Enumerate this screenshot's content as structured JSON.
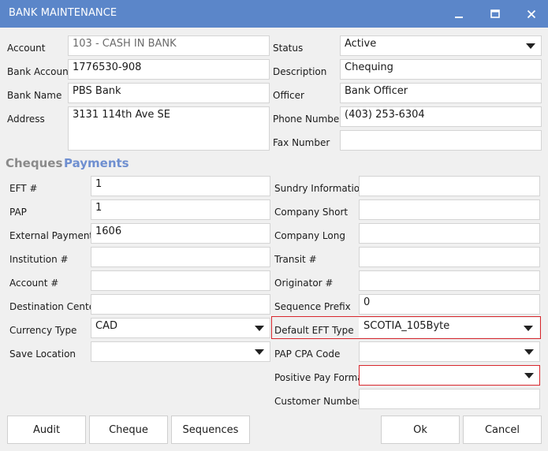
{
  "window": {
    "title": "BANK MAINTENANCE"
  },
  "bank": {
    "account_label": "Account",
    "account_value": "103 - CASH IN BANK",
    "bank_account_label": "Bank Account",
    "bank_account_value": "1776530-908",
    "bank_name_label": "Bank Name",
    "bank_name_value": "PBS Bank",
    "address_label": "Address",
    "address_value": "3131 114th Ave SE",
    "status_label": "Status",
    "status_value": "Active",
    "description_label": "Description",
    "description_value": "Chequing",
    "officer_label": "Officer",
    "officer_value": "Bank Officer",
    "phone_label": "Phone Number",
    "phone_value": "(403) 253-6304",
    "fax_label": "Fax Number",
    "fax_value": ""
  },
  "tabs": {
    "cheques": "Cheques",
    "payments": "Payments",
    "active": "payments"
  },
  "payments": {
    "left": [
      {
        "label": "EFT #",
        "value": "1"
      },
      {
        "label": "PAP",
        "value": "1"
      },
      {
        "label": "External Payments",
        "value": "1606"
      },
      {
        "label": "Institution #",
        "value": ""
      },
      {
        "label": "Account #",
        "value": ""
      },
      {
        "label": "Destination Center",
        "value": ""
      },
      {
        "label": "Currency Type",
        "value": "CAD"
      },
      {
        "label": "Save Location",
        "value": ""
      }
    ],
    "right": [
      {
        "label": "Sundry Information",
        "value": ""
      },
      {
        "label": "Company Short",
        "value": ""
      },
      {
        "label": "Company Long",
        "value": ""
      },
      {
        "label": "Transit #",
        "value": ""
      },
      {
        "label": "Originator #",
        "value": ""
      },
      {
        "label": "Sequence Prefix",
        "value": "0"
      },
      {
        "label": "Default EFT Type",
        "value": "SCOTIA_105Byte"
      },
      {
        "label": "PAP CPA Code",
        "value": ""
      },
      {
        "label": "Positive Pay Format",
        "value": ""
      },
      {
        "label": "Customer Number",
        "value": ""
      }
    ]
  },
  "buttons": {
    "audit": "Audit",
    "cheque": "Cheque",
    "sequences": "Sequences",
    "ok": "Ok",
    "cancel": "Cancel"
  },
  "colors": {
    "titlebar": "#5b86c9",
    "tab_active": "#6f8fd0",
    "tab_inactive": "#8a8a8a",
    "highlight": "#d8262c"
  }
}
